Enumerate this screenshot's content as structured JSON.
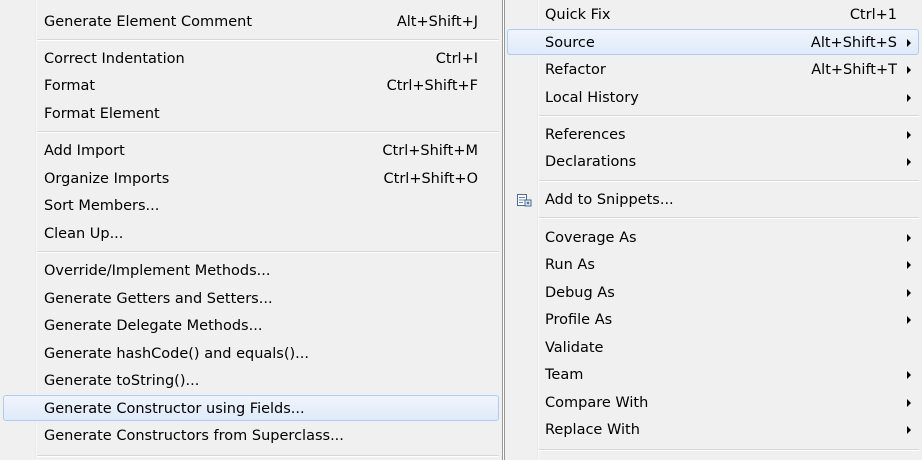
{
  "left_menu": {
    "items": [
      {
        "label": "Generate Element Comment",
        "accel": "Alt+Shift+J"
      },
      {
        "label": "Correct Indentation",
        "accel": "Ctrl+I"
      },
      {
        "label": "Format",
        "accel": "Ctrl+Shift+F"
      },
      {
        "label": "Format Element",
        "accel": ""
      },
      {
        "label": "Add Import",
        "accel": "Ctrl+Shift+M"
      },
      {
        "label": "Organize Imports",
        "accel": "Ctrl+Shift+O"
      },
      {
        "label": "Sort Members...",
        "accel": ""
      },
      {
        "label": "Clean Up...",
        "accel": ""
      },
      {
        "label": "Override/Implement Methods...",
        "accel": ""
      },
      {
        "label": "Generate Getters and Setters...",
        "accel": ""
      },
      {
        "label": "Generate Delegate Methods...",
        "accel": ""
      },
      {
        "label": "Generate hashCode() and equals()...",
        "accel": ""
      },
      {
        "label": "Generate toString()...",
        "accel": ""
      },
      {
        "label": "Generate Constructor using Fields...",
        "accel": "",
        "highlighted": true
      },
      {
        "label": "Generate Constructors from Superclass...",
        "accel": ""
      }
    ]
  },
  "right_menu": {
    "items": [
      {
        "label": "Quick Fix",
        "accel": "Ctrl+1",
        "submenu": false
      },
      {
        "label": "Source",
        "accel": "Alt+Shift+S",
        "submenu": true,
        "highlighted": true
      },
      {
        "label": "Refactor",
        "accel": "Alt+Shift+T",
        "submenu": true
      },
      {
        "label": "Local History",
        "accel": "",
        "submenu": true
      },
      {
        "label": "References",
        "accel": "",
        "submenu": true
      },
      {
        "label": "Declarations",
        "accel": "",
        "submenu": true
      },
      {
        "label": "Add to Snippets...",
        "accel": "",
        "submenu": false,
        "icon": "snippet-icon"
      },
      {
        "label": "Coverage As",
        "accel": "",
        "submenu": true
      },
      {
        "label": "Run As",
        "accel": "",
        "submenu": true
      },
      {
        "label": "Debug As",
        "accel": "",
        "submenu": true
      },
      {
        "label": "Profile As",
        "accel": "",
        "submenu": true
      },
      {
        "label": "Validate",
        "accel": "",
        "submenu": false
      },
      {
        "label": "Team",
        "accel": "",
        "submenu": true
      },
      {
        "label": "Compare With",
        "accel": "",
        "submenu": true
      },
      {
        "label": "Replace With",
        "accel": "",
        "submenu": true
      }
    ]
  },
  "colors": {
    "menu_background": "#f0f0f0",
    "highlight_background": "#dfeafa",
    "highlight_border": "#aeccf1",
    "separator": "#d7d7d7",
    "menu_border": "#979797"
  }
}
